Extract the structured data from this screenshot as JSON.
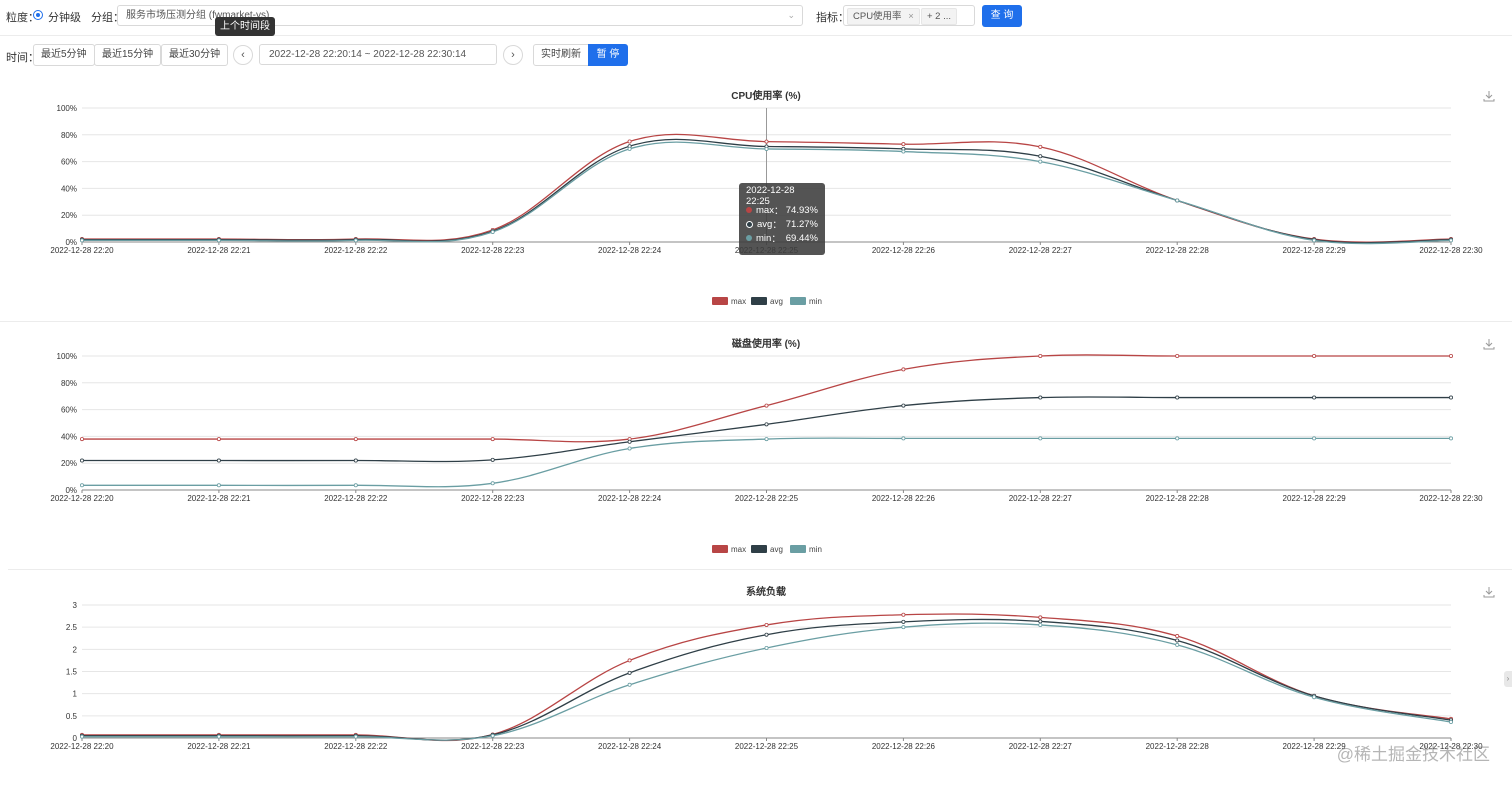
{
  "toolbar": {
    "granularity_label": "粒度：",
    "granularity_option": "分钟级",
    "group_label": "分组：",
    "group_value": "服务市场压测分组 (fwmarket-ys)",
    "metric_label": "指标：",
    "metric_tag": "CPU使用率",
    "metric_more": "+ 2 ...",
    "query_button": "查 询",
    "time_label": "时间：",
    "quick_5": "最近5分钟",
    "quick_15": "最近15分钟",
    "quick_30": "最近30分钟",
    "range_value": "2022-12-28 22:20:14 ~ 2022-12-28 22:30:14",
    "realtime_button": "实时刷新",
    "pause_button": "暂 停",
    "prev_tooltip": "上个时间段"
  },
  "colors": {
    "max": "#b84545",
    "avg": "#2f3f47",
    "min": "#6a9ea3",
    "primary": "#1f6feb"
  },
  "tooltip": {
    "time": "2022-12-28 22:25",
    "rows": [
      {
        "name": "max",
        "value": "74.93%"
      },
      {
        "name": "avg",
        "value": "71.27%"
      },
      {
        "name": "min",
        "value": "69.44%"
      }
    ]
  },
  "watermark": "@稀土掘金技术社区",
  "chart_data": [
    {
      "type": "line",
      "title": "CPU使用率 (%)",
      "x": [
        "2022-12-28 22:20",
        "2022-12-28 22:21",
        "2022-12-28 22:22",
        "2022-12-28 22:23",
        "2022-12-28 22:24",
        "2022-12-28 22:25",
        "2022-12-28 22:26",
        "2022-12-28 22:27",
        "2022-12-28 22:28",
        "2022-12-28 22:29",
        "2022-12-28 22:30"
      ],
      "yticks": [
        "0%",
        "20%",
        "40%",
        "60%",
        "80%",
        "100%"
      ],
      "ylim": [
        0,
        100
      ],
      "legend_position": "bottom",
      "series": [
        {
          "name": "max",
          "values": [
            2.2,
            2.2,
            2.2,
            9,
            75,
            74.93,
            73,
            71,
            31,
            2.2,
            2.2
          ]
        },
        {
          "name": "avg",
          "values": [
            1.8,
            1.8,
            1.8,
            8,
            71.5,
            71.27,
            69.5,
            64,
            31,
            1.8,
            1.8
          ]
        },
        {
          "name": "min",
          "values": [
            1.2,
            1.2,
            1.2,
            7.5,
            69.5,
            69.44,
            67.5,
            60,
            31,
            1.2,
            1.2
          ]
        }
      ]
    },
    {
      "type": "line",
      "title": "磁盘使用率 (%)",
      "x": [
        "2022-12-28 22:20",
        "2022-12-28 22:21",
        "2022-12-28 22:22",
        "2022-12-28 22:23",
        "2022-12-28 22:24",
        "2022-12-28 22:25",
        "2022-12-28 22:26",
        "2022-12-28 22:27",
        "2022-12-28 22:28",
        "2022-12-28 22:29",
        "2022-12-28 22:30"
      ],
      "yticks": [
        "0%",
        "20%",
        "40%",
        "60%",
        "80%",
        "100%"
      ],
      "ylim": [
        0,
        100
      ],
      "legend_position": "bottom",
      "series": [
        {
          "name": "max",
          "values": [
            38,
            38,
            38,
            38,
            38,
            63,
            90,
            100,
            100,
            100,
            100
          ]
        },
        {
          "name": "avg",
          "values": [
            22,
            22,
            22,
            22.5,
            36,
            49,
            63,
            69,
            69,
            69,
            69
          ]
        },
        {
          "name": "min",
          "values": [
            3.5,
            3.5,
            3.5,
            5,
            31,
            38,
            38.5,
            38.5,
            38.5,
            38.5,
            38.5
          ]
        }
      ]
    },
    {
      "type": "line",
      "title": "系统负载",
      "x": [
        "2022-12-28 22:20",
        "2022-12-28 22:21",
        "2022-12-28 22:22",
        "2022-12-28 22:23",
        "2022-12-28 22:24",
        "2022-12-28 22:25",
        "2022-12-28 22:26",
        "2022-12-28 22:27",
        "2022-12-28 22:28",
        "2022-12-28 22:29",
        "2022-12-28 22:30"
      ],
      "yticks": [
        "0",
        "0.5",
        "1",
        "1.5",
        "2",
        "2.5",
        "3"
      ],
      "ylim": [
        0,
        3
      ],
      "legend_position": "bottom",
      "series": [
        {
          "name": "max",
          "values": [
            0.07,
            0.07,
            0.07,
            0.08,
            1.75,
            2.55,
            2.78,
            2.72,
            2.3,
            0.95,
            0.43
          ]
        },
        {
          "name": "avg",
          "values": [
            0.05,
            0.05,
            0.05,
            0.07,
            1.47,
            2.33,
            2.62,
            2.63,
            2.2,
            0.95,
            0.4
          ]
        },
        {
          "name": "min",
          "values": [
            0.03,
            0.03,
            0.03,
            0.05,
            1.2,
            2.03,
            2.5,
            2.55,
            2.1,
            0.92,
            0.36
          ]
        }
      ]
    }
  ]
}
